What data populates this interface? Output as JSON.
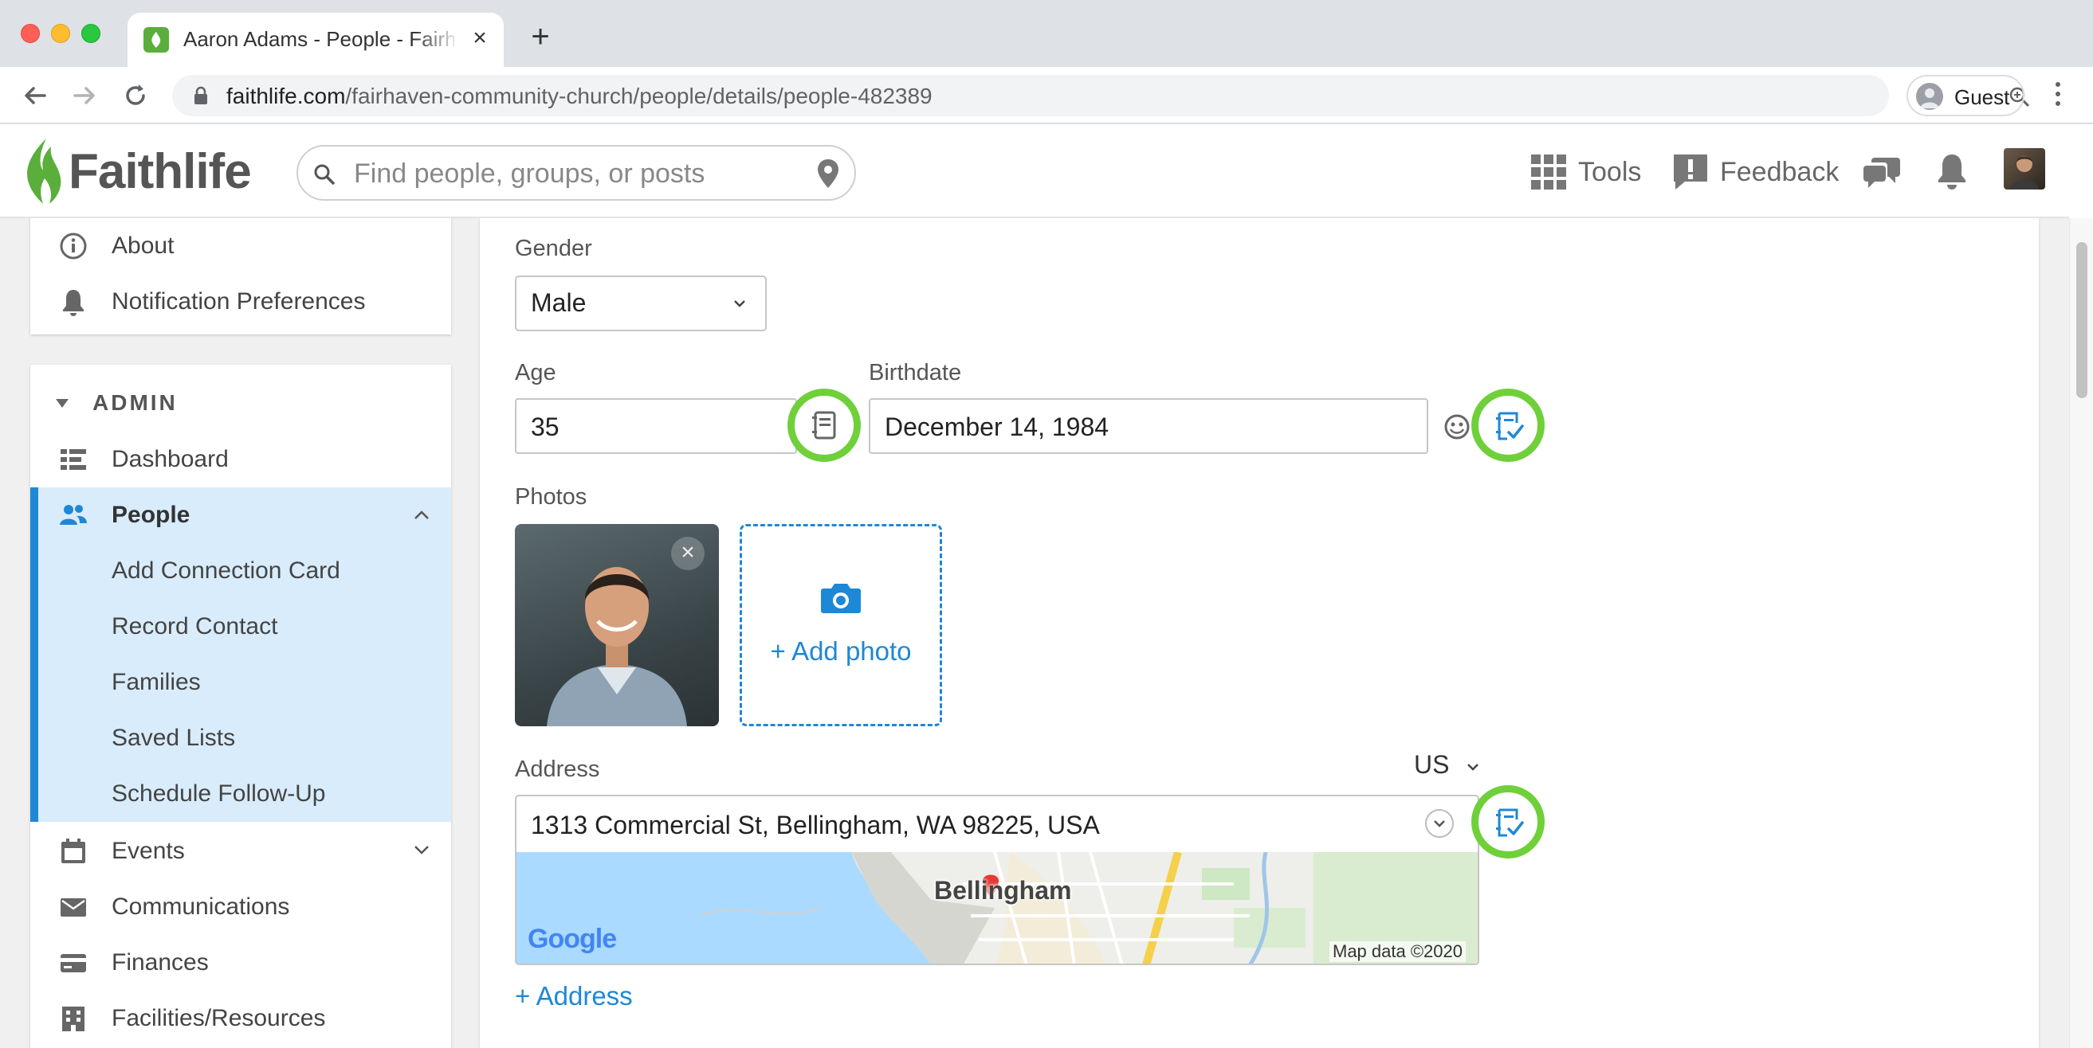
{
  "browser": {
    "tab_title": "Aaron Adams - People - Fairhaven Community Church",
    "url_host": "faithlife.com",
    "url_path": "/fairhaven-community-church/people/details/people-482389",
    "profile_label": "Guest"
  },
  "header": {
    "brand": "Faithlife",
    "search_placeholder": "Find people, groups, or posts",
    "tools_label": "Tools",
    "feedback_label": "Feedback"
  },
  "sidebar": {
    "top_items": [
      {
        "label": "About",
        "icon": "info-icon"
      },
      {
        "label": "Notification Preferences",
        "icon": "bell-icon"
      }
    ],
    "admin_heading": "ADMIN",
    "admin_items": [
      {
        "label": "Dashboard",
        "icon": "dashboard-icon"
      },
      {
        "label": "People",
        "icon": "people-icon",
        "active": true
      },
      {
        "label": "Add Connection Card"
      },
      {
        "label": "Record Contact"
      },
      {
        "label": "Families"
      },
      {
        "label": "Saved Lists"
      },
      {
        "label": "Schedule Follow-Up"
      },
      {
        "label": "Events",
        "icon": "calendar-icon"
      },
      {
        "label": "Communications",
        "icon": "envelope-icon"
      },
      {
        "label": "Finances",
        "icon": "credit-card-icon"
      },
      {
        "label": "Facilities/Resources",
        "icon": "building-icon"
      }
    ]
  },
  "form": {
    "gender_label": "Gender",
    "gender_value": "Male",
    "age_label": "Age",
    "age_value": "35",
    "birthdate_label": "Birthdate",
    "birthdate_value": "December 14, 1984",
    "photos_label": "Photos",
    "add_photo_label": "+ Add photo",
    "address_label": "Address",
    "country": "US",
    "address_value": "1313 Commercial St, Bellingham, WA 98225, USA",
    "map_city": "Bellingham",
    "map_google": "Google",
    "map_data": "Map data ©2020",
    "add_address_label": "+ Address"
  },
  "colors": {
    "accent_blue": "#1e88d6",
    "highlight_green": "#6fd03a",
    "brand_green": "#5aae3b"
  }
}
